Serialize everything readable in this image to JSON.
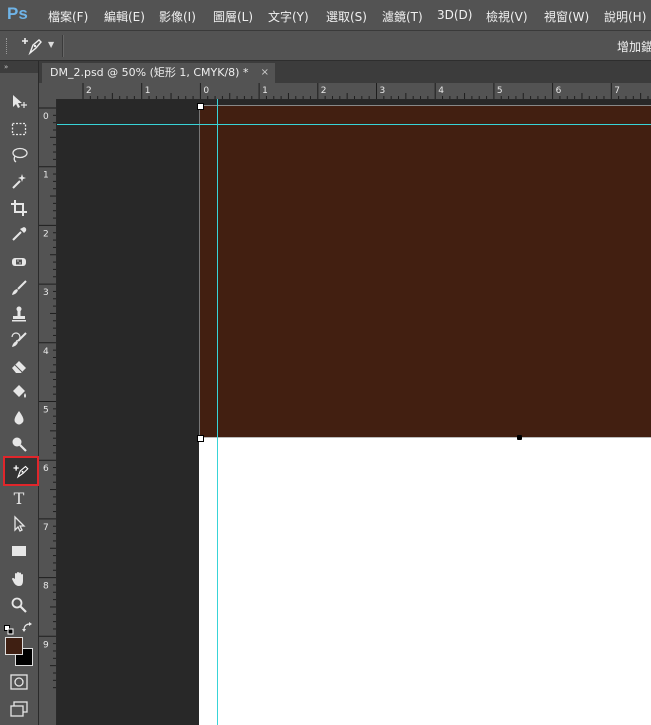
{
  "app": {
    "logo": "Ps"
  },
  "menu": [
    {
      "label": "檔案(F)"
    },
    {
      "label": "編輯(E)"
    },
    {
      "label": "影像(I)"
    },
    {
      "label": "圖層(L)"
    },
    {
      "label": "文字(Y)"
    },
    {
      "label": "選取(S)"
    },
    {
      "label": "濾鏡(T)"
    },
    {
      "label": "3D(D)"
    },
    {
      "label": "檢視(V)"
    },
    {
      "label": "視窗(W)"
    },
    {
      "label": "說明(H)"
    }
  ],
  "options_bar": {
    "tool_icon": "add-anchor-point-icon",
    "right_label": "增加錨"
  },
  "toolbar": {
    "header": "»",
    "active_tool": "add-anchor-point-tool",
    "tools": [
      {
        "name": "move-tool",
        "icon": "move-icon"
      },
      {
        "name": "marquee-tool",
        "icon": "marquee-icon"
      },
      {
        "name": "lasso-tool",
        "icon": "lasso-icon"
      },
      {
        "name": "magic-wand-tool",
        "icon": "magic-wand-icon"
      },
      {
        "name": "crop-tool",
        "icon": "crop-icon"
      },
      {
        "name": "eyedropper-tool",
        "icon": "eyedropper-icon"
      },
      {
        "name": "healing-brush-tool",
        "icon": "bandage-icon"
      },
      {
        "name": "brush-tool",
        "icon": "brush-icon"
      },
      {
        "name": "clone-stamp-tool",
        "icon": "stamp-icon"
      },
      {
        "name": "history-brush-tool",
        "icon": "history-brush-icon"
      },
      {
        "name": "eraser-tool",
        "icon": "eraser-icon"
      },
      {
        "name": "paint-bucket-tool",
        "icon": "paint-bucket-icon"
      },
      {
        "name": "blur-tool",
        "icon": "droplet-icon"
      },
      {
        "name": "dodge-tool",
        "icon": "dodge-icon"
      },
      {
        "name": "add-anchor-point-tool",
        "icon": "add-anchor-pen-icon"
      },
      {
        "name": "type-tool",
        "icon": "type-icon",
        "glyph": "T"
      },
      {
        "name": "path-selection-tool",
        "icon": "direct-select-arrow-icon"
      },
      {
        "name": "rectangle-tool",
        "icon": "rectangle-icon"
      },
      {
        "name": "hand-tool",
        "icon": "hand-icon"
      },
      {
        "name": "zoom-tool",
        "icon": "zoom-icon"
      }
    ],
    "foreground_color": "#3f1f12",
    "background_color": "#000000"
  },
  "document": {
    "tab_title": "DM_2.psd @ 50% (矩形 1, CMYK/8) *",
    "close_glyph": "×",
    "shape_color": "#421f11",
    "canvas_color": "#ffffff",
    "guide_color": "#38d4d8"
  },
  "rulers": {
    "horizontal": [
      "2",
      "1",
      "0",
      "1",
      "2",
      "3",
      "4",
      "5",
      "6",
      "7"
    ],
    "vertical": [
      "0",
      "1",
      "2",
      "3",
      "4",
      "5",
      "6",
      "7",
      "8",
      "9"
    ]
  }
}
